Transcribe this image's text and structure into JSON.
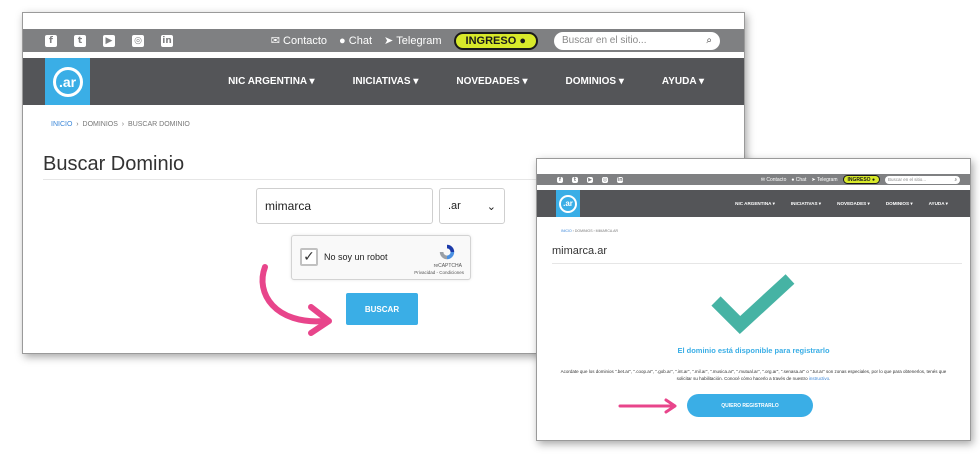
{
  "colors": {
    "topbar": "#7f8082",
    "navbar": "#545558",
    "accent_blue": "#3aaee6",
    "ingreso_yellow": "#d8e92a",
    "pink_arrow": "#e8458b",
    "check_teal": "#46b3a4"
  },
  "social_icons": [
    "facebook-icon",
    "twitter-icon",
    "youtube-icon",
    "instagram-icon",
    "linkedin-icon"
  ],
  "header": {
    "contacto": "Contacto",
    "chat": "Chat",
    "telegram": "Telegram",
    "ingreso": "INGRESO",
    "search_placeholder": "Buscar en el sitio...",
    "logo_text": ".ar"
  },
  "nav": [
    "NIC ARGENTINA",
    "INICIATIVAS",
    "NOVEDADES",
    "DOMINIOS",
    "AYUDA"
  ],
  "search_page": {
    "breadcrumb": [
      "INICIO",
      "DOMINIOS",
      "BUSCAR DOMINIO"
    ],
    "title": "Buscar Dominio",
    "domain_value": "mimarca",
    "tld_value": ".ar",
    "captcha_label": "No soy un robot",
    "captcha_brand": "reCAPTCHA",
    "captcha_links": "Privacidad - Condiciones",
    "button": "BUSCAR"
  },
  "result_page": {
    "breadcrumb": [
      "INICIO",
      "DOMINIOS",
      "MIMARCA.AR"
    ],
    "title": "mimarca.ar",
    "message": "El dominio está disponible para registrarlo",
    "notice": "Acordate que los dominios \".bet.ar\", \".coop.ar\", \".gob.ar\", \".int.ar\", \".mil.ar\", \".musica.ar\", \".mutual.ar\", \".org.ar\", \".senasa.ar\" o \".tur.ar\" son zonas especiales, por lo que para obtenerlos, tenés que solicitar su habilitación. Conocé cómo hacerlo a través de nuestro",
    "notice_link": "instructivo",
    "button": "QUIERO REGISTRARLO"
  }
}
